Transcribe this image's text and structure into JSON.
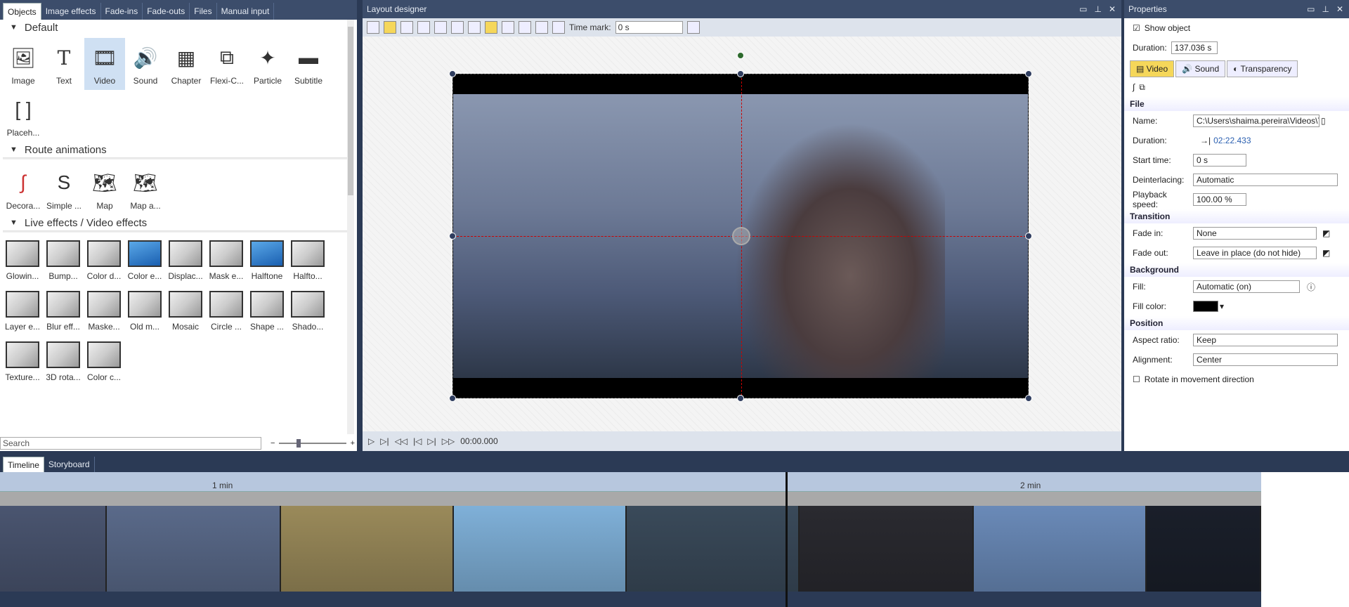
{
  "objects_panel": {
    "tabs": [
      "Objects",
      "Image effects",
      "Fade-ins",
      "Fade-outs",
      "Files",
      "Manual input"
    ],
    "sections": {
      "default": {
        "title": "Default",
        "items": [
          "Image",
          "Text",
          "Video",
          "Sound",
          "Chapter",
          "Flexi-C...",
          "Particle",
          "Subtitle",
          "Placeh..."
        ]
      },
      "route": {
        "title": "Route animations",
        "items": [
          "Decora...",
          "Simple ...",
          "Map",
          "Map a..."
        ]
      },
      "live": {
        "title": "Live effects / Video effects",
        "items": [
          "Glowin...",
          "Bump...",
          "Color d...",
          "Color e...",
          "Displac...",
          "Mask e...",
          "Halftone",
          "Halfto...",
          "Layer e...",
          "Blur eff...",
          "Maske...",
          "Old m...",
          "Mosaic",
          "Circle ...",
          "Shape ...",
          "Shado...",
          "Texture...",
          "3D rota...",
          "Color c..."
        ]
      }
    },
    "search_placeholder": "Search"
  },
  "designer": {
    "title": "Layout designer",
    "time_mark_label": "Time mark:",
    "time_mark_value": "0 s",
    "playback_time": "00:00.000"
  },
  "properties": {
    "title": "Properties",
    "show_object": "Show object",
    "duration_label": "Duration:",
    "duration_value": "137.036 s",
    "tabs": [
      "Video",
      "Sound",
      "Transparency"
    ],
    "file": {
      "group": "File",
      "name_label": "Name:",
      "name_value": "C:\\Users\\shaima.pereira\\Videos\\You",
      "duration_label": "Duration:",
      "duration_value": "02:22.433",
      "start_label": "Start time:",
      "start_value": "0 s",
      "deint_label": "Deinterlacing:",
      "deint_value": "Automatic",
      "speed_label": "Playback speed:",
      "speed_value": "100.00 %"
    },
    "transition": {
      "group": "Transition",
      "fadein_label": "Fade in:",
      "fadein_value": "None",
      "fadeout_label": "Fade out:",
      "fadeout_value": "Leave in place (do not hide)"
    },
    "background": {
      "group": "Background",
      "fill_label": "Fill:",
      "fill_value": "Automatic (on)",
      "color_label": "Fill color:",
      "color_value": "#000000"
    },
    "position": {
      "group": "Position",
      "aspect_label": "Aspect ratio:",
      "aspect_value": "Keep",
      "align_label": "Alignment:",
      "align_value": "Center",
      "rotate_label": "Rotate in movement direction"
    }
  },
  "timeline": {
    "tabs": [
      "Timeline",
      "Storyboard"
    ],
    "ruler_marks": [
      "1 min",
      "2 min"
    ],
    "clip_colors": [
      "#4a5570",
      "#5a6a8a",
      "#9a8a5a",
      "#7fb0d8",
      "#3a4a5a",
      "#2a2a30",
      "#6a8ab8",
      "#1a1f2a"
    ]
  }
}
